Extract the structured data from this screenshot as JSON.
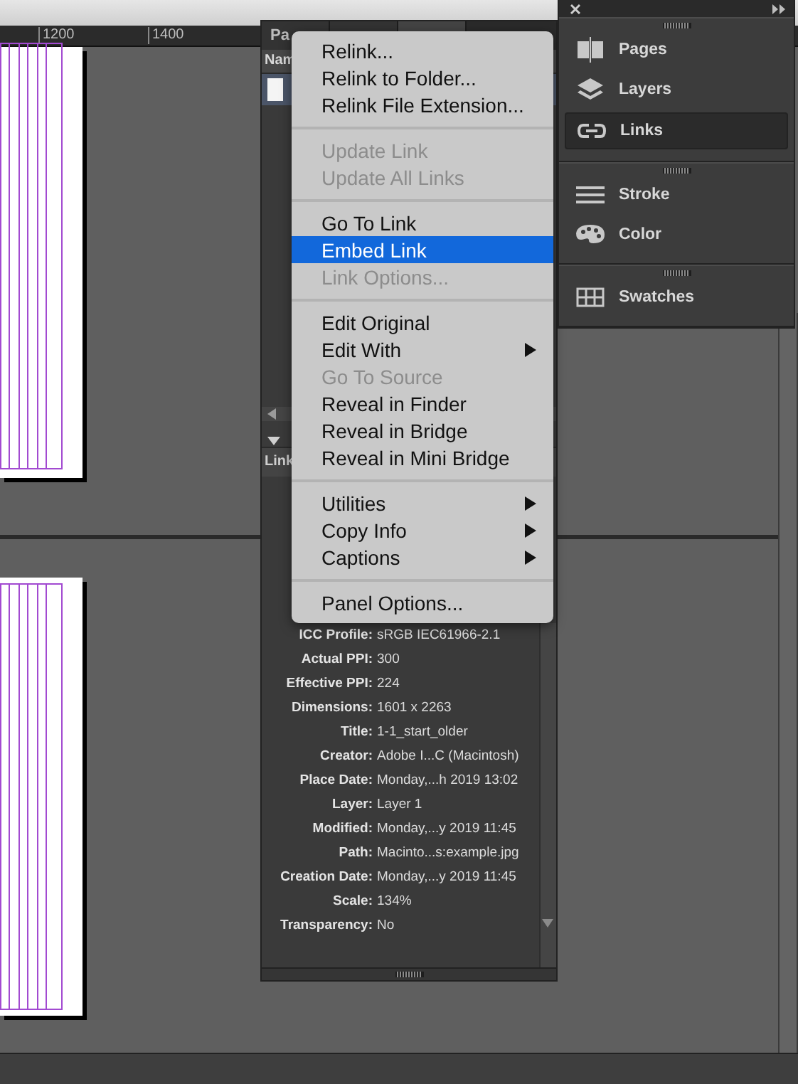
{
  "ruler": {
    "labels": [
      "1200",
      "1400"
    ]
  },
  "links_panel": {
    "tabs": [
      {
        "label": "Pa",
        "selected": false
      },
      {
        "selected": false
      },
      {
        "selected": true
      }
    ],
    "column_header": "Nam",
    "rows": [
      {
        "selected": true
      }
    ],
    "info_header": "Link",
    "info": [
      {
        "label": "ICC Profile:",
        "value": "sRGB IEC61966-2.1"
      },
      {
        "label": "Actual PPI:",
        "value": "300"
      },
      {
        "label": "Effective PPI:",
        "value": "224"
      },
      {
        "label": "Dimensions:",
        "value": "1601 x 2263"
      },
      {
        "label": "Title:",
        "value": "1-1_start_older"
      },
      {
        "label": "Creator:",
        "value": "Adobe I...C (Macintosh)"
      },
      {
        "label": "Place Date:",
        "value": "Monday,...h 2019 13:02"
      },
      {
        "label": "Layer:",
        "value": "Layer 1"
      },
      {
        "label": "Modified:",
        "value": "Monday,...y 2019 11:45"
      },
      {
        "label": "Path:",
        "value": "Macinto...s:example.jpg"
      },
      {
        "label": "Creation Date:",
        "value": "Monday,...y 2019 11:45"
      },
      {
        "label": "Scale:",
        "value": "134%"
      },
      {
        "label": "Transparency:",
        "value": "No"
      }
    ]
  },
  "menu": {
    "items": [
      {
        "kind": "item",
        "label": "Relink...",
        "disabled": false,
        "selected": false,
        "submenu": false
      },
      {
        "kind": "item",
        "label": "Relink to Folder...",
        "disabled": false,
        "selected": false,
        "submenu": false
      },
      {
        "kind": "item",
        "label": "Relink File Extension...",
        "disabled": false,
        "selected": false,
        "submenu": false
      },
      {
        "kind": "separator"
      },
      {
        "kind": "item",
        "label": "Update Link",
        "disabled": true,
        "selected": false,
        "submenu": false
      },
      {
        "kind": "item",
        "label": "Update All Links",
        "disabled": true,
        "selected": false,
        "submenu": false
      },
      {
        "kind": "separator"
      },
      {
        "kind": "item",
        "label": "Go To Link",
        "disabled": false,
        "selected": false,
        "submenu": false
      },
      {
        "kind": "item",
        "label": "Embed Link",
        "disabled": false,
        "selected": true,
        "submenu": false
      },
      {
        "kind": "item",
        "label": "Link Options...",
        "disabled": true,
        "selected": false,
        "submenu": false
      },
      {
        "kind": "separator"
      },
      {
        "kind": "item",
        "label": "Edit Original",
        "disabled": false,
        "selected": false,
        "submenu": false
      },
      {
        "kind": "item",
        "label": "Edit With",
        "disabled": false,
        "selected": false,
        "submenu": true
      },
      {
        "kind": "item",
        "label": "Go To Source",
        "disabled": true,
        "selected": false,
        "submenu": false
      },
      {
        "kind": "item",
        "label": "Reveal in Finder",
        "disabled": false,
        "selected": false,
        "submenu": false
      },
      {
        "kind": "item",
        "label": "Reveal in Bridge",
        "disabled": false,
        "selected": false,
        "submenu": false
      },
      {
        "kind": "item",
        "label": "Reveal in Mini Bridge",
        "disabled": false,
        "selected": false,
        "submenu": false
      },
      {
        "kind": "separator"
      },
      {
        "kind": "item",
        "label": "Utilities",
        "disabled": false,
        "selected": false,
        "submenu": true
      },
      {
        "kind": "item",
        "label": "Copy Info",
        "disabled": false,
        "selected": false,
        "submenu": true
      },
      {
        "kind": "item",
        "label": "Captions",
        "disabled": false,
        "selected": false,
        "submenu": true
      },
      {
        "kind": "separator"
      },
      {
        "kind": "item",
        "label": "Panel Options...",
        "disabled": false,
        "selected": false,
        "submenu": false
      }
    ]
  },
  "dock": {
    "groups": [
      [
        {
          "label": "Pages",
          "selected": false
        },
        {
          "label": "Layers",
          "selected": false
        },
        {
          "label": "Links",
          "selected": true
        }
      ],
      [
        {
          "label": "Stroke",
          "selected": false
        },
        {
          "label": "Color",
          "selected": false
        }
      ],
      [
        {
          "label": "Swatches",
          "selected": false
        }
      ]
    ]
  }
}
